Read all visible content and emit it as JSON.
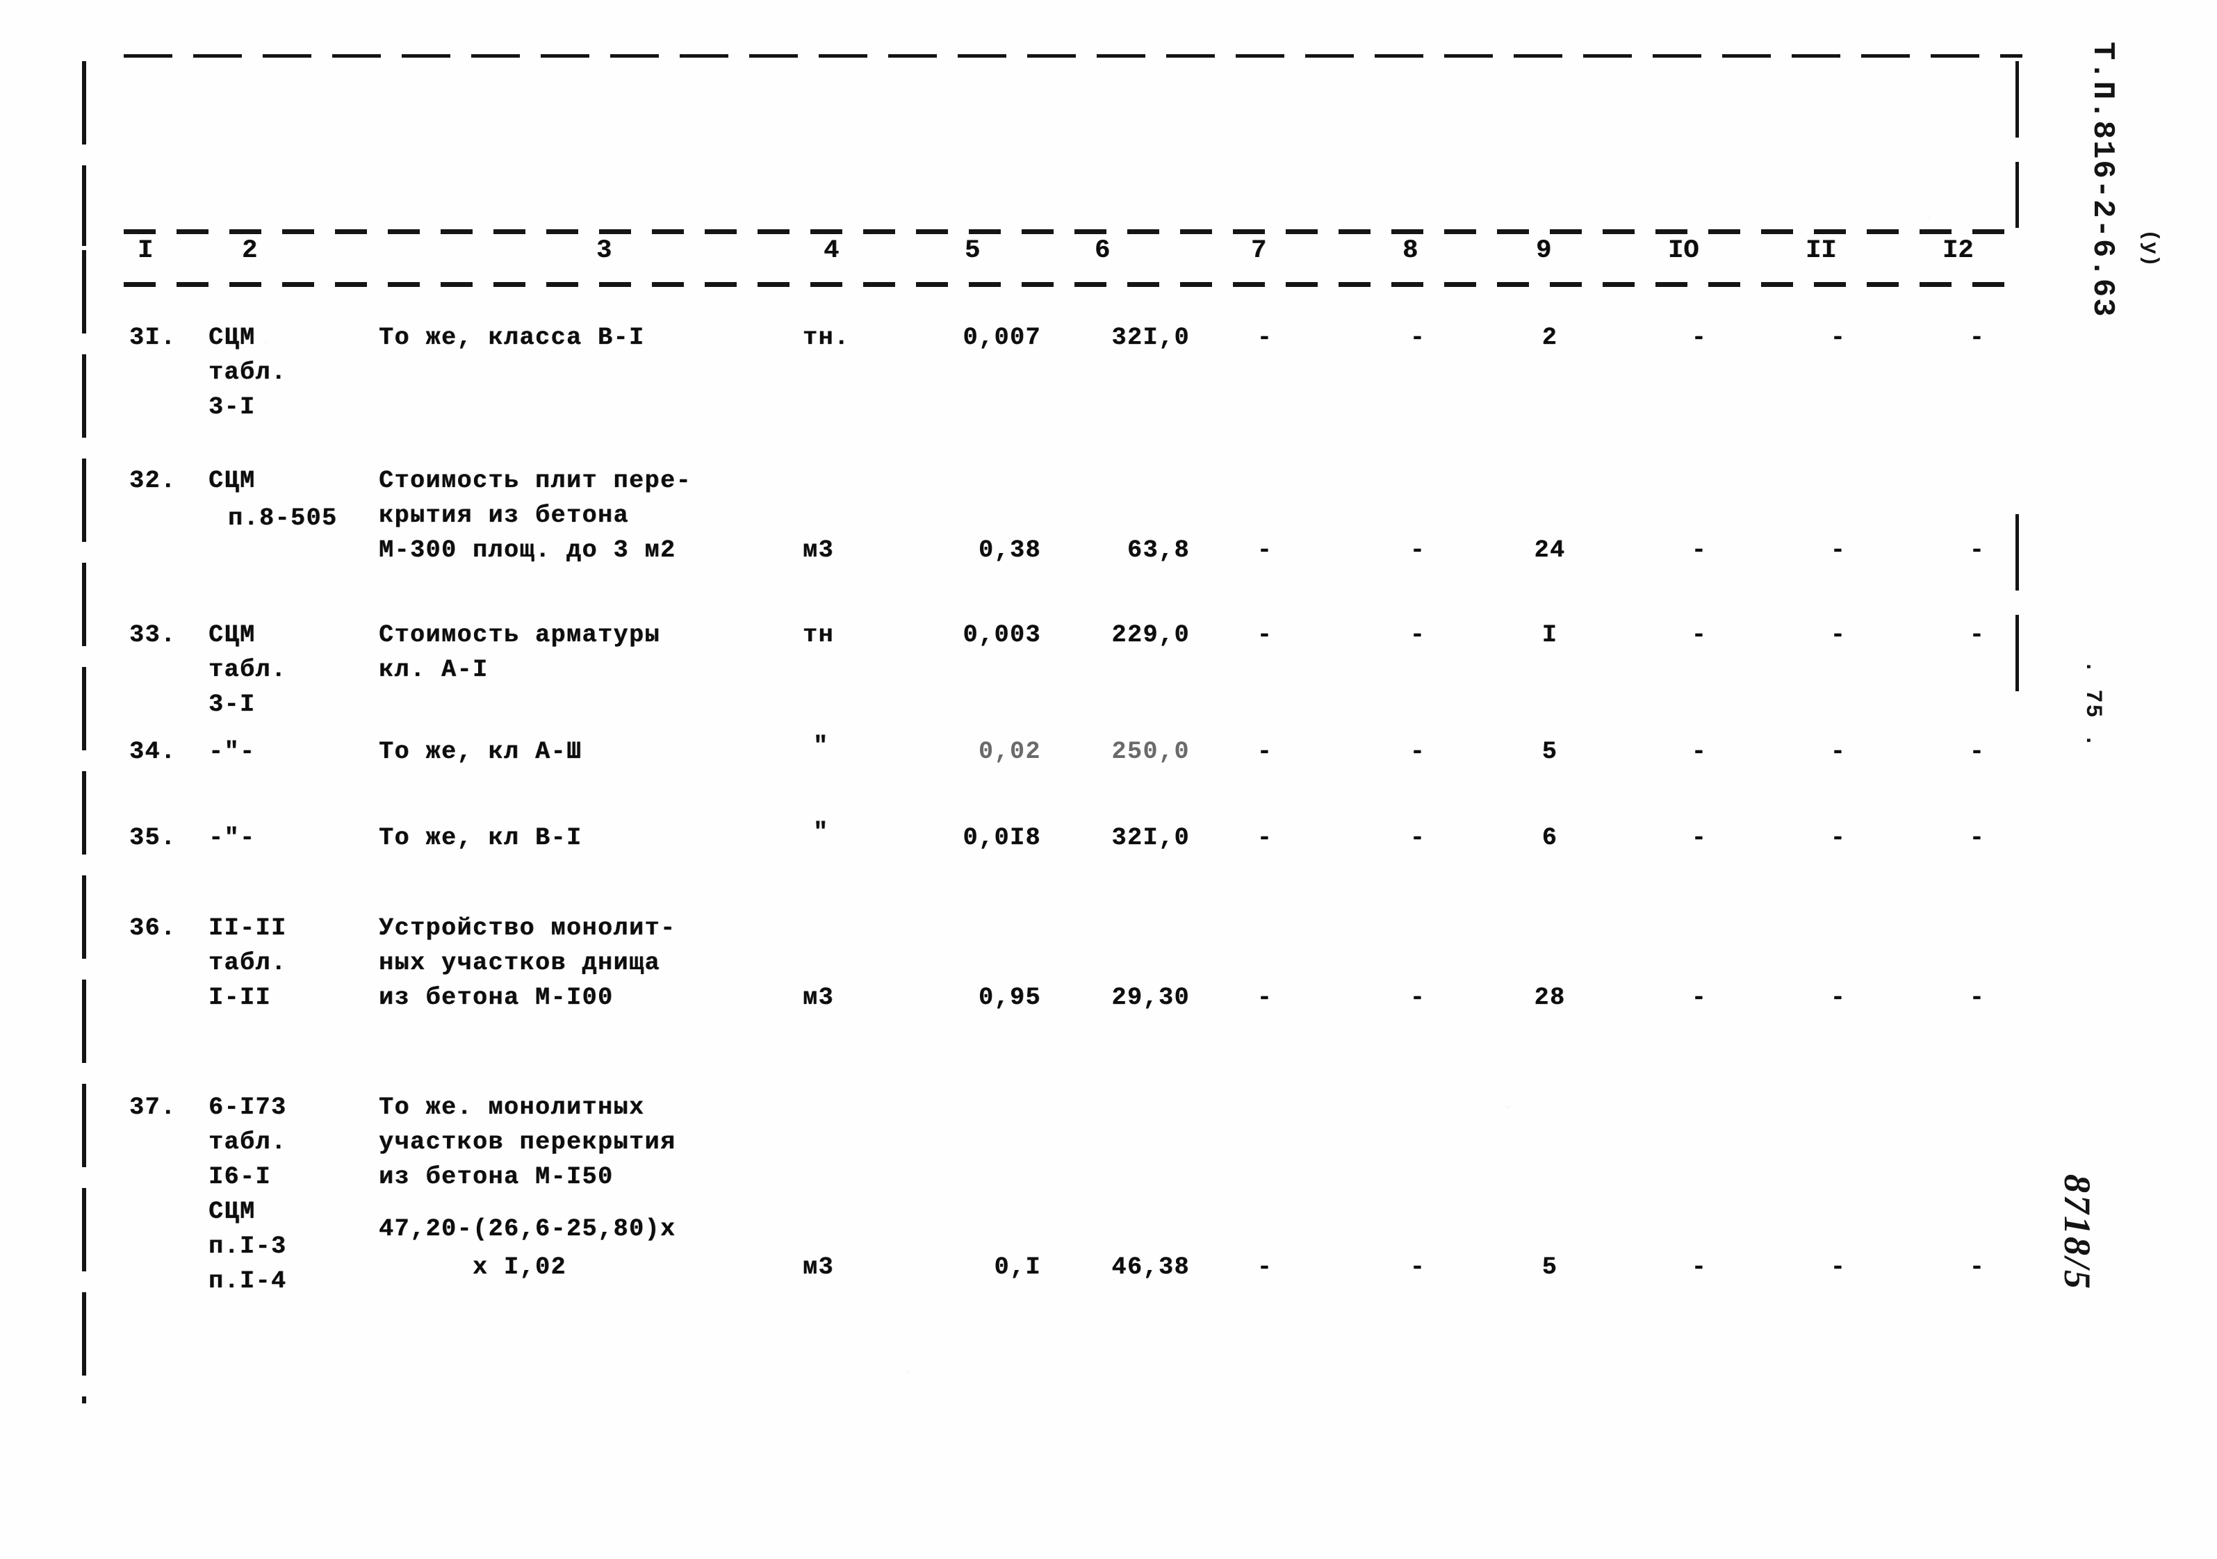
{
  "document": {
    "doc_id_stamp": "Т.П.816-2-6.63",
    "doc_id_sub": "(у)",
    "page_number_stamp": ". 75 .",
    "archive_mark": "8718/5"
  },
  "table": {
    "column_headers": [
      "I",
      "2",
      "3",
      "4",
      "5",
      "6",
      "7",
      "8",
      "9",
      "IO",
      "II",
      "I2"
    ],
    "rows": [
      {
        "no": "3I.",
        "code": [
          "СЦМ",
          "табл.",
          "3-I"
        ],
        "description": [
          "То же, класса В-I"
        ],
        "unit": "тн.",
        "qty": "0,007",
        "price": "32I,0",
        "col7": "-",
        "col8": "-",
        "col9": "2",
        "col10": "-",
        "col11": "-",
        "col12": "-"
      },
      {
        "no": "32.",
        "code": [
          "СЦМ",
          "п.8-505"
        ],
        "description": [
          "Стоимость плит пере-",
          "крытия из бетона",
          "М-300 площ. до 3 м2"
        ],
        "unit": "м3",
        "qty": "0,38",
        "price": "63,8",
        "col7": "-",
        "col8": "-",
        "col9": "24",
        "col10": "-",
        "col11": "-",
        "col12": "-"
      },
      {
        "no": "33.",
        "code": [
          "СЦМ",
          "табл.",
          "3-I"
        ],
        "description": [
          "Стоимость арматуры",
          "кл. А-I"
        ],
        "unit": "тн",
        "qty": "0,003",
        "price": "229,0",
        "col7": "-",
        "col8": "-",
        "col9": "I",
        "col10": "-",
        "col11": "-",
        "col12": "-"
      },
      {
        "no": "34.",
        "code": [
          "-\"-"
        ],
        "description": [
          "То же, кл А-Ш"
        ],
        "unit": "\"",
        "qty": "0,02",
        "price": "250,0",
        "col7": "-",
        "col8": "-",
        "col9": "5",
        "col10": "-",
        "col11": "-",
        "col12": "-",
        "faded_values": true
      },
      {
        "no": "35.",
        "code": [
          "-\"-"
        ],
        "description": [
          "То же, кл В-I"
        ],
        "unit": "\"",
        "qty": "0,0I8",
        "price": "32I,0",
        "col7": "-",
        "col8": "-",
        "col9": "6",
        "col10": "-",
        "col11": "-",
        "col12": "-"
      },
      {
        "no": "36.",
        "code": [
          "II-II",
          "табл.",
          "I-II"
        ],
        "description": [
          "Устройство монолит-",
          "ных участков днища",
          "из бетона М-I00"
        ],
        "unit": "м3",
        "qty": "0,95",
        "price": "29,30",
        "col7": "-",
        "col8": "-",
        "col9": "28",
        "col10": "-",
        "col11": "-",
        "col12": "-"
      },
      {
        "no": "37.",
        "code": [
          "6-I73",
          "табл.",
          "I6-I",
          "СЦМ",
          "п.I-3",
          "п.I-4"
        ],
        "description": [
          "То же. монолитных",
          "участков перекрытия",
          "из бетона М-I50",
          "47,20-(26,6-25,80)х",
          "      х I,02"
        ],
        "unit": "м3",
        "qty": "0,I",
        "price": "46,38",
        "col7": "-",
        "col8": "-",
        "col9": "5",
        "col10": "-",
        "col11": "-",
        "col12": "-"
      }
    ]
  }
}
